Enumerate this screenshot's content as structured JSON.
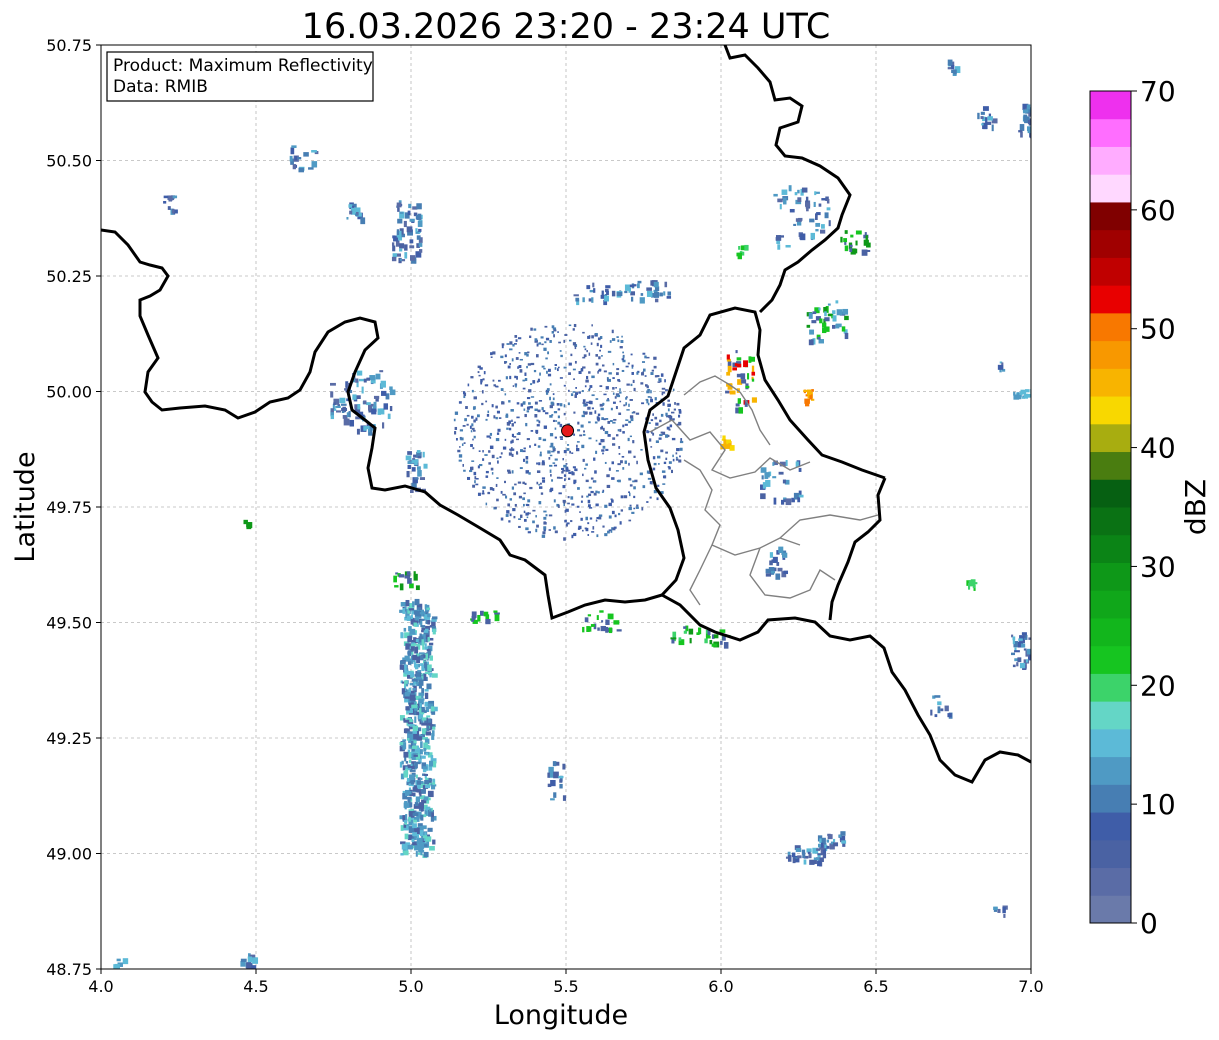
{
  "title": "16.03.2026 23:20 - 23:24 UTC",
  "info": {
    "product": "Product: Maximum Reflectivity",
    "data": "Data: RMIB"
  },
  "axes": {
    "xlabel": "Longitude",
    "ylabel": "Latitude",
    "xlim": [
      4.0,
      7.0
    ],
    "ylim": [
      48.75,
      50.75
    ],
    "xticks": [
      "4.0",
      "4.5",
      "5.0",
      "5.5",
      "6.0",
      "6.5",
      "7.0"
    ],
    "yticks": [
      "50.75",
      "50.50",
      "50.25",
      "50.00",
      "49.75",
      "49.50",
      "49.25",
      "49.00",
      "48.75"
    ],
    "grid": true
  },
  "radar_site": {
    "lon": 5.505,
    "lat": 49.915,
    "color": "#e41a1c"
  },
  "colorbar": {
    "label": "dBZ",
    "ticks": [
      "0",
      "10",
      "20",
      "30",
      "40",
      "50",
      "60",
      "70"
    ],
    "range": [
      0,
      70
    ],
    "colors": [
      "#6a7aaa",
      "#5a6ca6",
      "#4a62a3",
      "#3f5da8",
      "#477eb3",
      "#4f9ac4",
      "#5cbad7",
      "#64d6c6",
      "#3cd36a",
      "#16c520",
      "#12b61c",
      "#10a71a",
      "#0e9818",
      "#0b8416",
      "#0a7214",
      "#066012",
      "#4a7d10",
      "#a8ad10",
      "#f8d800",
      "#f8b400",
      "#f89800",
      "#f87800",
      "#e80000",
      "#c00000",
      "#a00000",
      "#800000",
      "#ffd8ff",
      "#ffacff",
      "#ff6eff",
      "#ee30ee"
    ]
  },
  "legend_placement": "top-left"
}
